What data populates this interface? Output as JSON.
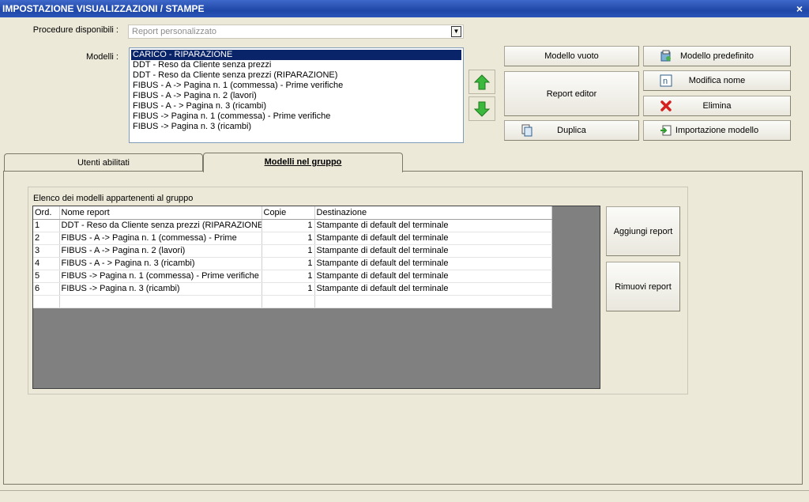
{
  "window": {
    "title": "IMPOSTAZIONE VISUALIZZAZIONI / STAMPE",
    "close_glyph": "×"
  },
  "procedure": {
    "label": "Procedure disponibili :",
    "value": "Report personalizzato"
  },
  "modelli": {
    "label": "Modelli :",
    "items": [
      "CARICO - RIPARAZIONE",
      "DDT - Reso da Cliente senza prezzi",
      "DDT - Reso da Cliente senza prezzi (RIPARAZIONE)",
      "FIBUS - A -> Pagina n. 1 (commessa) - Prime verifiche",
      "FIBUS - A -> Pagina n. 2 (lavori)",
      "FIBUS - A - > Pagina n. 3 (ricambi)",
      "FIBUS -> Pagina n. 1 (commessa) - Prime verifiche",
      "FIBUS -> Pagina n. 3 (ricambi)"
    ],
    "selected_index": 0
  },
  "buttons": {
    "modello_vuoto": "Modello vuoto",
    "modello_predefinito": "Modello predefinito",
    "report_editor": "Report editor",
    "modifica_nome": "Modifica nome",
    "elimina": "Elimina",
    "duplica": "Duplica",
    "importazione_modello": "Importazione modello",
    "aggiungi_report": "Aggiungi report",
    "rimuovi_report": "Rimuovi report"
  },
  "icons": {
    "move_up": "green-up-arrow-icon",
    "move_down": "green-down-arrow-icon",
    "modello_predefinito": "template-icon",
    "modifica_nome": "rename-icon",
    "elimina": "red-x-icon",
    "duplica": "copy-icon",
    "importazione_modello": "import-icon"
  },
  "tabs": [
    {
      "label": "Utenti abilitati",
      "active": false
    },
    {
      "label": "Modelli nel gruppo",
      "active": true
    }
  ],
  "group": {
    "title": "Elenco dei modelli appartenenti al gruppo",
    "columns": [
      "Ord.",
      "Nome report",
      "Copie",
      "Destinazione"
    ],
    "rows": [
      [
        "1",
        "DDT - Reso da Cliente senza prezzi (RIPARAZIONE)",
        "1",
        "Stampante di default del terminale"
      ],
      [
        "2",
        "FIBUS - A -> Pagina n. 1 (commessa) - Prime",
        "1",
        "Stampante di default del terminale"
      ],
      [
        "3",
        "FIBUS - A -> Pagina n. 2 (lavori)",
        "1",
        "Stampante di default del terminale"
      ],
      [
        "4",
        "FIBUS - A - > Pagina n. 3 (ricambi)",
        "1",
        "Stampante di default del terminale"
      ],
      [
        "5",
        "FIBUS -> Pagina n. 1 (commessa) - Prime verifiche",
        "1",
        "Stampante di default del terminale"
      ],
      [
        "6",
        "FIBUS -> Pagina n. 3 (ricambi)",
        "1",
        "Stampante di default del terminale"
      ]
    ]
  },
  "colors": {
    "titlebar": "#2a55b8",
    "selection": "#0a246a",
    "grid_background": "#808080",
    "window": "#ece9d8"
  }
}
